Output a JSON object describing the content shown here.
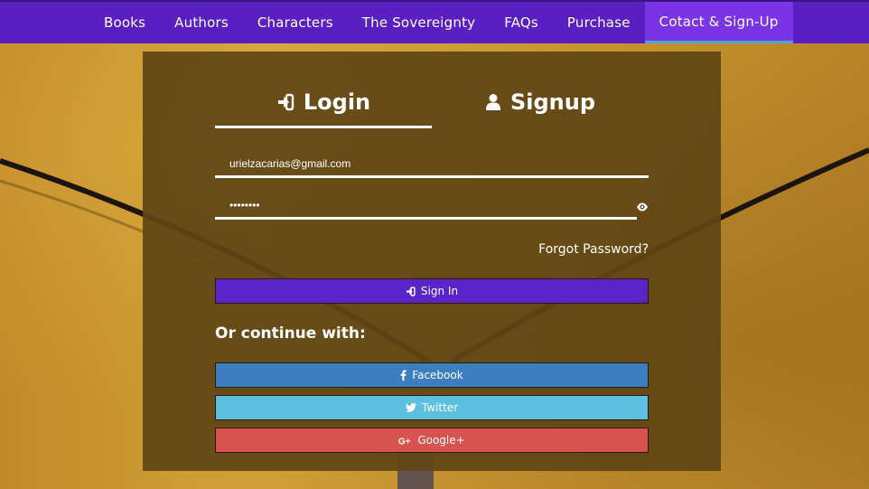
{
  "nav": {
    "items": [
      {
        "label": "Books",
        "active": false
      },
      {
        "label": "Authors",
        "active": false
      },
      {
        "label": "Characters",
        "active": false
      },
      {
        "label": "The Sovereignty",
        "active": false
      },
      {
        "label": "FAQs",
        "active": false
      },
      {
        "label": "Purchase",
        "active": false
      },
      {
        "label": "Cotact & Sign-Up",
        "active": true
      }
    ]
  },
  "auth": {
    "tabs": {
      "login": {
        "label": "Login",
        "icon": "sign-in-icon",
        "active": true
      },
      "signup": {
        "label": "Signup",
        "icon": "user-icon",
        "active": false
      }
    },
    "email_value": "urielzacarias@gmail.com",
    "password_value": "••••••••",
    "password_toggle_icon": "eye-icon",
    "forgot_label": "Forgot Password?",
    "signin_label": "Sign In",
    "signin_icon": "sign-in-icon",
    "continue_label": "Or continue with:",
    "social": {
      "facebook": {
        "label": "Facebook",
        "icon": "facebook-icon"
      },
      "twitter": {
        "label": "Twitter",
        "icon": "twitter-icon"
      },
      "google": {
        "label": "Google+",
        "icon": "google-plus-icon"
      }
    }
  },
  "colors": {
    "nav_bg": "#5a1fc0",
    "nav_active_bg": "#7b33e6",
    "nav_active_underline": "#4fa6d6",
    "panel_bg": "#604616",
    "signin_bg": "#5a24c8",
    "facebook_bg": "#3b7fc0",
    "twitter_bg": "#5cc0e0",
    "google_bg": "#d8534f"
  }
}
